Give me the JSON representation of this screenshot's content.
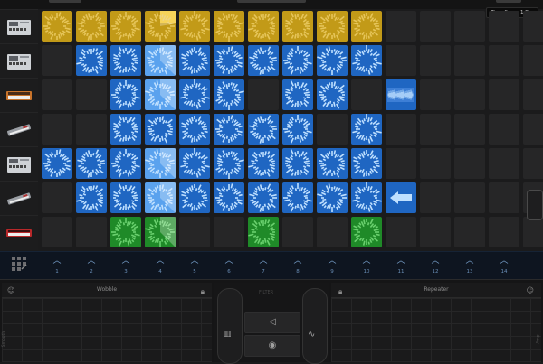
{
  "header": {
    "time_snap": "Time Snap: 1 Bar"
  },
  "colors": {
    "yellow": "#c29a18",
    "blue": "#1f66c2",
    "bright_blue": "#5aa2ee",
    "green": "#1f8a28",
    "empty": "#262627"
  },
  "instruments": [
    {
      "name": "drum-machine-icon"
    },
    {
      "name": "drum-machine-icon"
    },
    {
      "name": "keyboard-orange-icon"
    },
    {
      "name": "keyboard-red-icon"
    },
    {
      "name": "drum-machine-2-icon"
    },
    {
      "name": "synth-white-icon"
    },
    {
      "name": "synth-red-icon"
    }
  ],
  "grid": [
    [
      "Y",
      "Y",
      "Y",
      "Y*",
      "Y",
      "Y",
      "Y",
      "Y",
      "Y",
      "Y",
      "E",
      "E",
      "E",
      "E",
      "E"
    ],
    [
      "E",
      "B",
      "B",
      "B*",
      "B",
      "B",
      "B",
      "B",
      "B",
      "B",
      "E",
      "E",
      "E",
      "E",
      "E"
    ],
    [
      "E",
      "E",
      "B",
      "B*",
      "B",
      "B",
      "E",
      "B",
      "B",
      "E",
      "W",
      "E",
      "E",
      "E",
      "E"
    ],
    [
      "E",
      "E",
      "B",
      "B",
      "B",
      "B",
      "B",
      "B",
      "E",
      "B",
      "E",
      "E",
      "E",
      "E",
      "E"
    ],
    [
      "B",
      "B",
      "B",
      "B*",
      "B",
      "B",
      "B",
      "B",
      "B",
      "B",
      "E",
      "E",
      "E",
      "E",
      "E"
    ],
    [
      "E",
      "B",
      "B",
      "B*",
      "B",
      "B",
      "B",
      "B",
      "B",
      "B",
      "A",
      "E",
      "E",
      "E",
      "E"
    ],
    [
      "E",
      "E",
      "G",
      "G*",
      "E",
      "E",
      "G",
      "E",
      "E",
      "G",
      "E",
      "E",
      "E",
      "E",
      "E"
    ]
  ],
  "triggers": [
    "1",
    "2",
    "3",
    "4",
    "5",
    "6",
    "7",
    "8",
    "9",
    "10",
    "11",
    "12",
    "13",
    "14"
  ],
  "bottom": {
    "left_title": "Wobble",
    "right_title": "Repeater",
    "center_label": "FILTER",
    "left_side": "Smooth",
    "right_side": "Amp"
  }
}
